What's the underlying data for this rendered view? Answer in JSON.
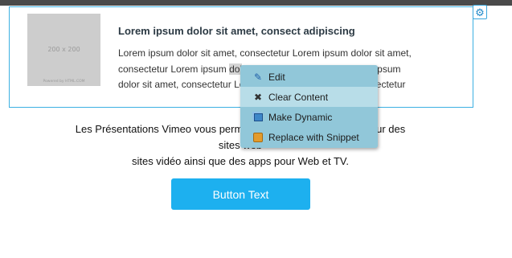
{
  "content_block": {
    "image_placeholder": {
      "dimensions": "200 x 200",
      "credit": "Powered by HTML.COM"
    },
    "title": "Lorem ipsum dolor sit amet, consect adipiscing",
    "body_before": "Lorem ipsum dolor sit amet, consectetur Lorem ipsum dolor sit amet, consectetur Lorem ipsum ",
    "body_selected": "dol",
    "body_after": "or sit amet, consectetur Lorem ipsum dolor sit amet, consectetur Lorem ipsum dolor sit amet, consectetur"
  },
  "presentation": {
    "line1": "Les Présentations Vimeo vous permettent d'intégrer des vidéos sur des sites web",
    "line2": "sites vidéo ainsi que des apps pour Web et TV."
  },
  "button": {
    "label": "Button Text"
  },
  "context_menu": {
    "items": [
      {
        "label": "Edit",
        "icon": "pencil-icon"
      },
      {
        "label": "Clear Content",
        "icon": "x-icon"
      },
      {
        "label": "Make Dynamic",
        "icon": "stacked-windows-icon"
      },
      {
        "label": "Replace with Snippet",
        "icon": "snippet-icon"
      }
    ],
    "highlighted_item": "Clear Content"
  },
  "colors": {
    "accent_border": "#3cb0e2",
    "button_background": "#1db0ef",
    "menu_background": "#91c7d9",
    "menu_hover": "#b8dde8"
  }
}
